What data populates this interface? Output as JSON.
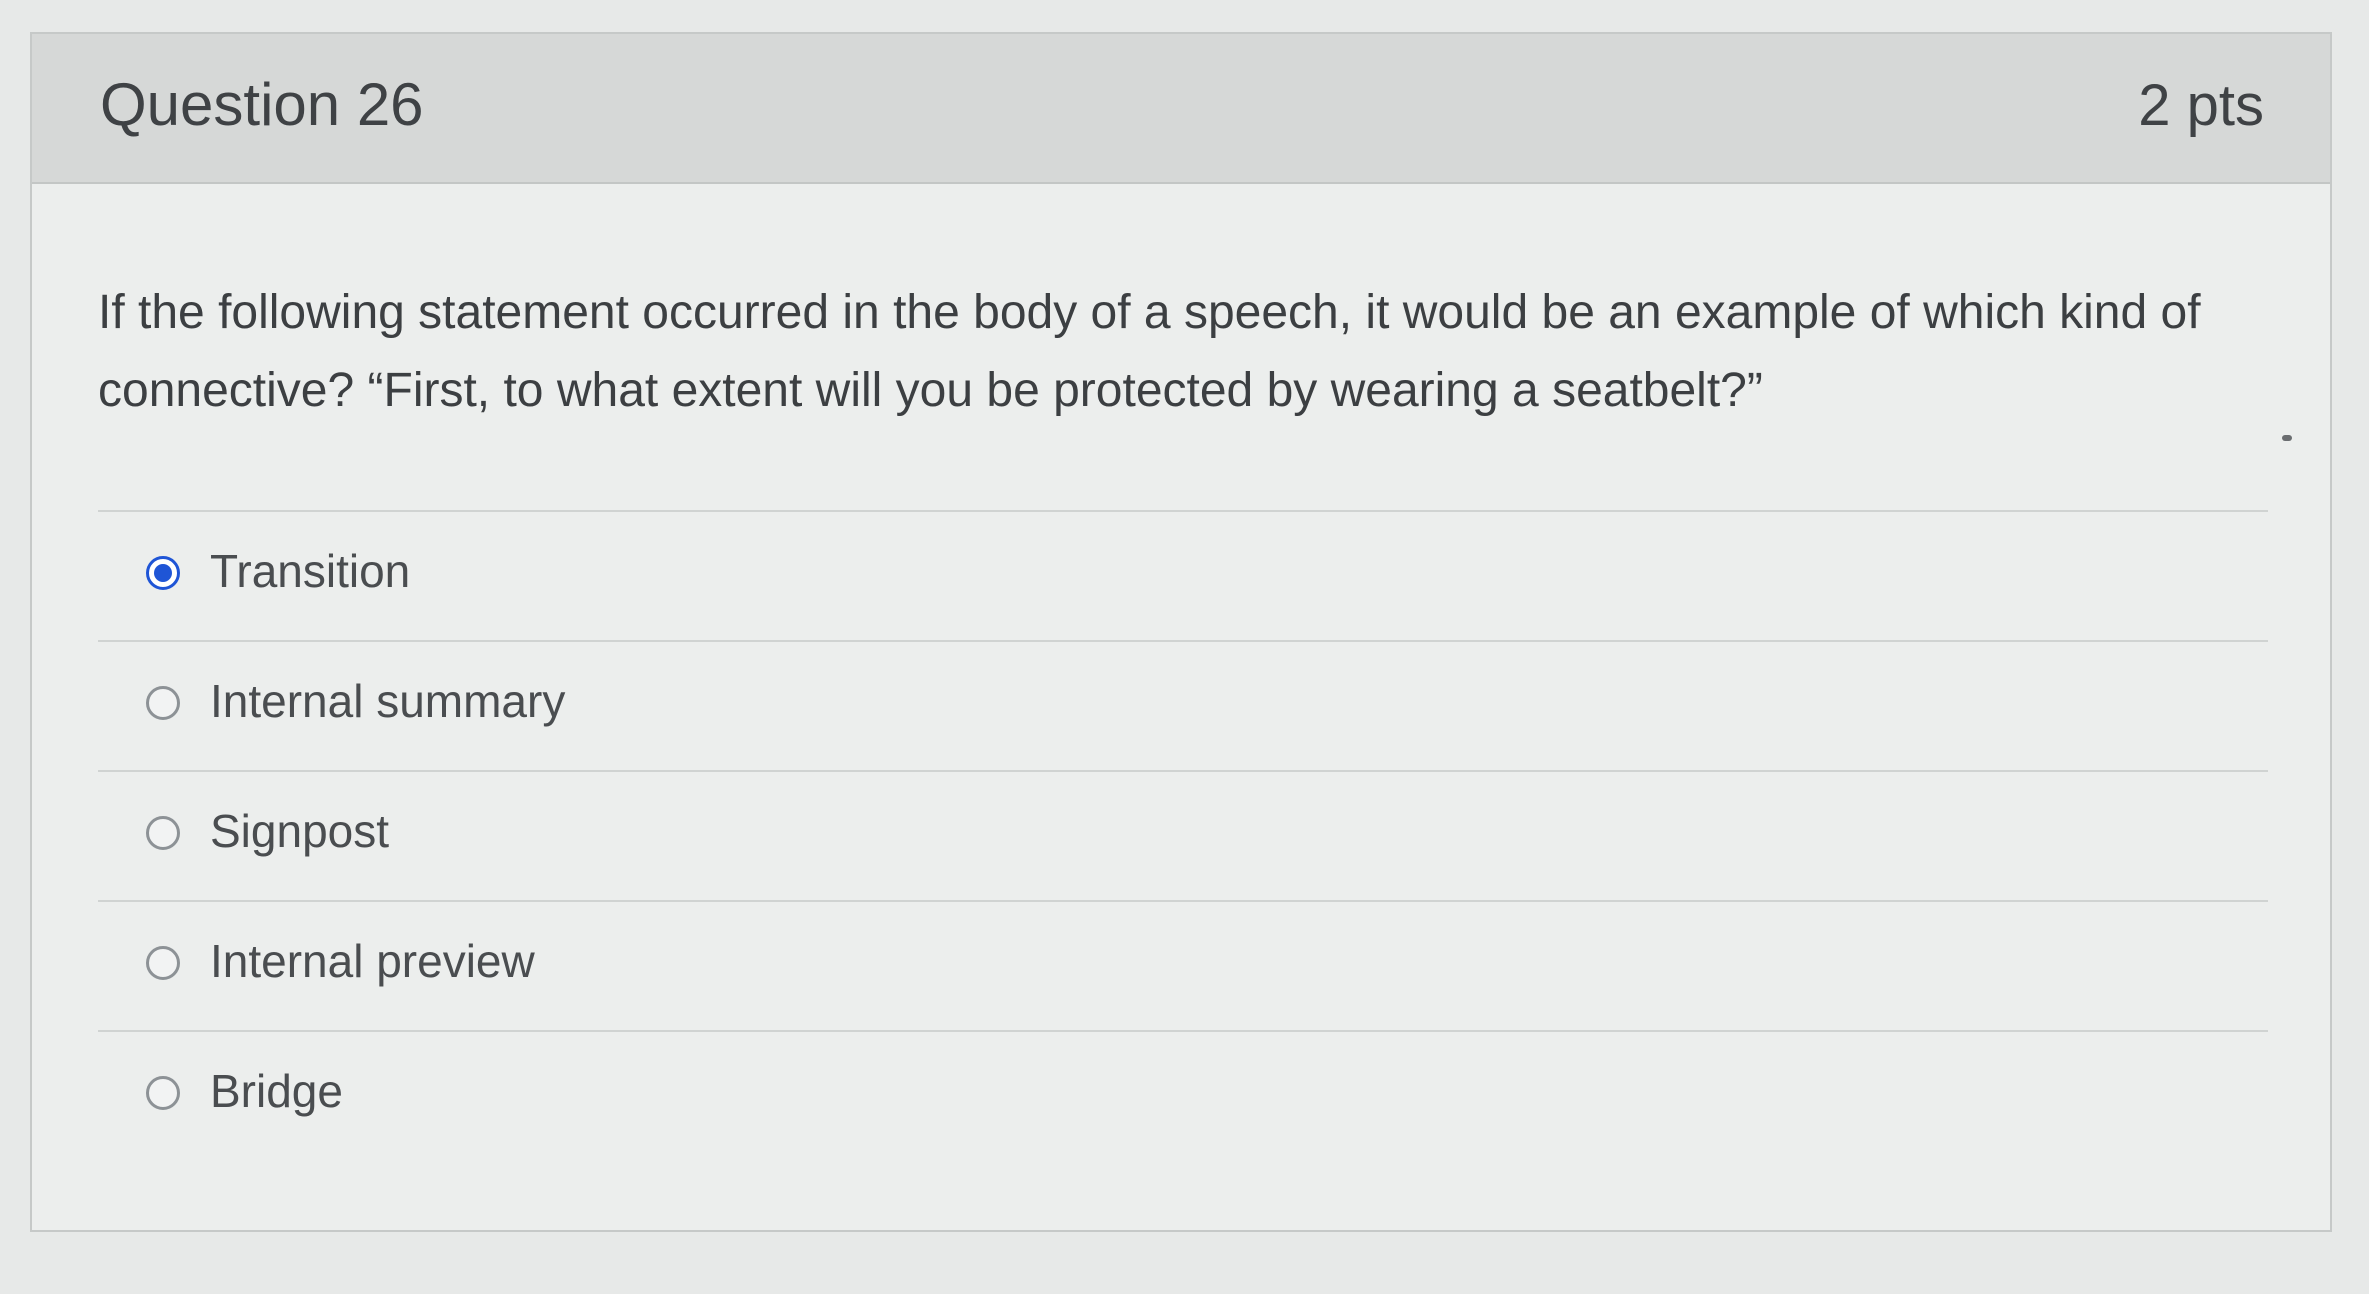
{
  "question": {
    "title": "Question 26",
    "points": "2 pts",
    "text": "If the following statement occurred in the body of a speech, it would be an example of which kind of connective? “First, to what extent will you be protected by wearing a seatbelt?”"
  },
  "answers": [
    {
      "label": "Transition",
      "selected": true
    },
    {
      "label": "Internal summary",
      "selected": false
    },
    {
      "label": "Signpost",
      "selected": false
    },
    {
      "label": "Internal preview",
      "selected": false
    },
    {
      "label": "Bridge",
      "selected": false
    }
  ],
  "colors": {
    "accent": "#1f55d6",
    "header_bg": "#d6d8d7",
    "card_bg": "#eceeed"
  }
}
